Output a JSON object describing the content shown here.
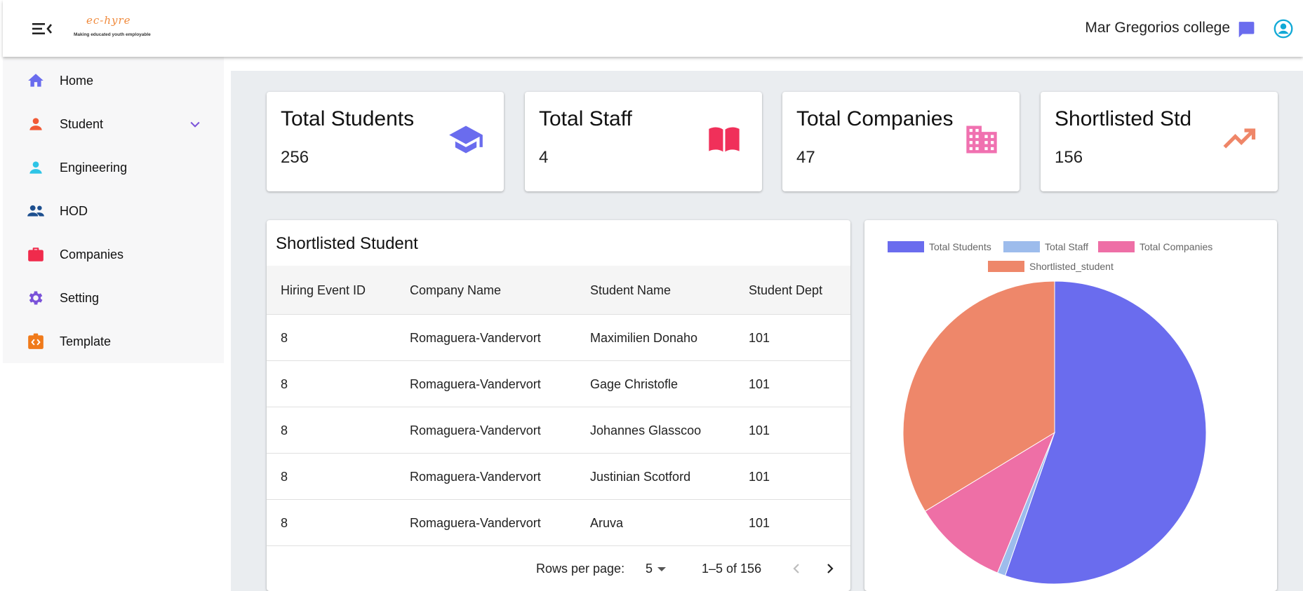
{
  "header": {
    "logo_script": "ec-hyre",
    "logo_tagline": "Making educated youth employable",
    "college_name": "Mar Gregorios college"
  },
  "sidebar": {
    "items": [
      {
        "label": "Home",
        "icon": "home-icon",
        "color": "#6a6cee"
      },
      {
        "label": "Student",
        "icon": "person-icon",
        "color": "#f15a36",
        "expandable": true
      },
      {
        "label": "Engineering",
        "icon": "person-icon",
        "color": "#2ec4e6"
      },
      {
        "label": "HOD",
        "icon": "group-icon",
        "color": "#1d4f8f"
      },
      {
        "label": "Companies",
        "icon": "briefcase-icon",
        "color": "#f02b4c"
      },
      {
        "label": "Setting",
        "icon": "gear-icon",
        "color": "#7a52d9"
      },
      {
        "label": "Template",
        "icon": "code-icon",
        "color": "#f07a1a"
      }
    ]
  },
  "stats": [
    {
      "title": "Total Students",
      "value": "256",
      "icon": "graduation-cap-icon",
      "color": "#6a6cee"
    },
    {
      "title": "Total Staff",
      "value": "4",
      "icon": "book-icon",
      "color": "#f0305a"
    },
    {
      "title": "Total Companies",
      "value": "47",
      "icon": "building-icon",
      "color": "#f071b0"
    },
    {
      "title": "Shortlisted Std",
      "value": "156",
      "icon": "trending-up-icon",
      "color": "#ef8668"
    }
  ],
  "table": {
    "title": "Shortlisted Student",
    "columns": [
      "Hiring Event ID",
      "Company Name",
      "Student Name",
      "Student Dept"
    ],
    "rows": [
      [
        "8",
        "Romaguera-Vandervort",
        "Maximilien Donaho",
        "101"
      ],
      [
        "8",
        "Romaguera-Vandervort",
        "Gage Christofle",
        "101"
      ],
      [
        "8",
        "Romaguera-Vandervort",
        "Johannes Glasscoo",
        "101"
      ],
      [
        "8",
        "Romaguera-Vandervort",
        "Justinian Scotford",
        "101"
      ],
      [
        "8",
        "Romaguera-Vandervort",
        "Aruva",
        "101"
      ]
    ],
    "pagination": {
      "rows_per_page_label": "Rows per page:",
      "rows_per_page": "5",
      "range": "1–5 of 156"
    }
  },
  "chart_data": {
    "type": "pie",
    "categories": [
      "Total Students",
      "Total Staff",
      "Total Companies",
      "Shortlisted_student"
    ],
    "values": [
      256,
      4,
      47,
      156
    ],
    "colors": [
      "#6a6cee",
      "#9dbcec",
      "#ee6fa6",
      "#ee876a"
    ],
    "legend_position": "top"
  }
}
